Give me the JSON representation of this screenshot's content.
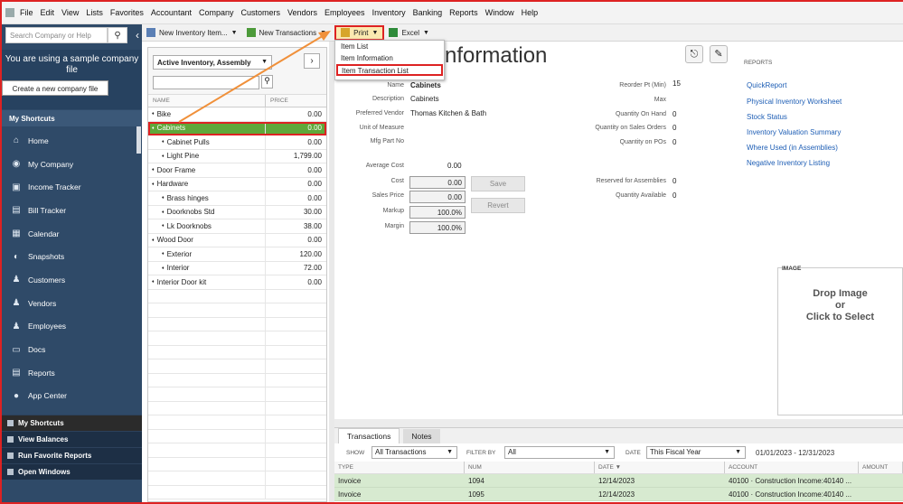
{
  "menubar": [
    "File",
    "Edit",
    "View",
    "Lists",
    "Favorites",
    "Accountant",
    "Company",
    "Customers",
    "Vendors",
    "Employees",
    "Inventory",
    "Banking",
    "Reports",
    "Window",
    "Help"
  ],
  "sidebar": {
    "search_placeholder": "Search Company or Help",
    "sample_text": "You are using a sample company file",
    "create_button": "Create a new company file",
    "shortcuts_heading": "My Shortcuts",
    "items": [
      {
        "label": "Home",
        "icon": "home-icon"
      },
      {
        "label": "My Company",
        "icon": "company-icon"
      },
      {
        "label": "Income Tracker",
        "icon": "income-tracker-icon"
      },
      {
        "label": "Bill Tracker",
        "icon": "bill-tracker-icon"
      },
      {
        "label": "Calendar",
        "icon": "calendar-icon"
      },
      {
        "label": "Snapshots",
        "icon": "snapshots-icon"
      },
      {
        "label": "Customers",
        "icon": "customers-icon"
      },
      {
        "label": "Vendors",
        "icon": "vendors-icon"
      },
      {
        "label": "Employees",
        "icon": "employees-icon"
      },
      {
        "label": "Docs",
        "icon": "docs-icon"
      },
      {
        "label": "Reports",
        "icon": "reports-icon"
      },
      {
        "label": "App Center",
        "icon": "app-center-icon"
      }
    ],
    "bottom": [
      "My Shortcuts",
      "View Balances",
      "Run Favorite Reports",
      "Open Windows"
    ]
  },
  "toolbar": {
    "new_item": "New Inventory Item...",
    "new_transactions": "New Transactions",
    "print": "Print",
    "excel": "Excel"
  },
  "print_menu": [
    "Item List",
    "Item Information",
    "Item Transaction List"
  ],
  "item_list": {
    "filter": "Active Inventory, Assembly",
    "col_name": "NAME",
    "col_price": "PRICE",
    "rows": [
      {
        "name": "Bike",
        "price": "0.00",
        "level": 0
      },
      {
        "name": "Cabinets",
        "price": "0.00",
        "level": 0,
        "selected": true
      },
      {
        "name": "Cabinet Pulls",
        "price": "0.00",
        "level": 1
      },
      {
        "name": "Light Pine",
        "price": "1,799.00",
        "level": 1
      },
      {
        "name": "Door Frame",
        "price": "0.00",
        "level": 0
      },
      {
        "name": "Hardware",
        "price": "0.00",
        "level": 0
      },
      {
        "name": "Brass hinges",
        "price": "0.00",
        "level": 1
      },
      {
        "name": "Doorknobs Std",
        "price": "30.00",
        "level": 1
      },
      {
        "name": "Lk Doorknobs",
        "price": "38.00",
        "level": 1
      },
      {
        "name": "Wood Door",
        "price": "0.00",
        "level": 0
      },
      {
        "name": "Exterior",
        "price": "120.00",
        "level": 1
      },
      {
        "name": "Interior",
        "price": "72.00",
        "level": 1
      },
      {
        "name": "Interior Door kit",
        "price": "0.00",
        "level": 0
      }
    ]
  },
  "info": {
    "title": "nformation",
    "name_label": "Name",
    "name": "Cabinets",
    "desc_label": "Description",
    "desc": "Cabinets",
    "vendor_label": "Preferred Vendor",
    "vendor": "Thomas Kitchen & Bath",
    "uom_label": "Unit of Measure",
    "mfg_label": "Mfg Part No",
    "avg_cost_label": "Average Cost",
    "avg_cost": "0.00",
    "cost_label": "Cost",
    "cost": "0.00",
    "sales_price_label": "Sales Price",
    "sales_price": "0.00",
    "markup_label": "Markup",
    "markup": "100.0%",
    "margin_label": "Margin",
    "margin": "100.0%",
    "save": "Save",
    "revert": "Revert",
    "reorder_label": "Reorder Pt (Min)",
    "reorder": "15",
    "max_label": "Max",
    "qoh_label": "Quantity On Hand",
    "qoh": "0",
    "qso_label": "Quantity on Sales Orders",
    "qso": "0",
    "qpo_label": "Quantity on POs",
    "qpo": "0",
    "reserved_label": "Reserved for Assemblies",
    "reserved": "0",
    "available_label": "Quantity Available",
    "available": "0"
  },
  "reports": {
    "heading": "REPORTS",
    "links": [
      "QuickReport",
      "Physical Inventory Worksheet",
      "Stock Status",
      "Inventory Valuation Summary",
      "Where Used (in Assemblies)",
      "Negative Inventory Listing"
    ]
  },
  "image": {
    "label": "IMAGE",
    "drop1": "Drop Image",
    "drop2": "or",
    "drop3": "Click to Select"
  },
  "transactions": {
    "tab1": "Transactions",
    "tab2": "Notes",
    "show_label": "SHOW",
    "show": "All Transactions",
    "filter_label": "FILTER BY",
    "filter": "All",
    "date_label": "DATE",
    "date": "This Fiscal Year",
    "range": "01/01/2023 - 12/31/2023",
    "cols": [
      "TYPE",
      "NUM",
      "DATE ▼",
      "ACCOUNT",
      "AMOUNT"
    ],
    "rows": [
      [
        "Invoice",
        "1094",
        "12/14/2023",
        "40100 · Construction Income:40140 ...",
        ""
      ],
      [
        "Invoice",
        "1095",
        "12/14/2023",
        "40100 · Construction Income:40140 ...",
        ""
      ]
    ]
  }
}
